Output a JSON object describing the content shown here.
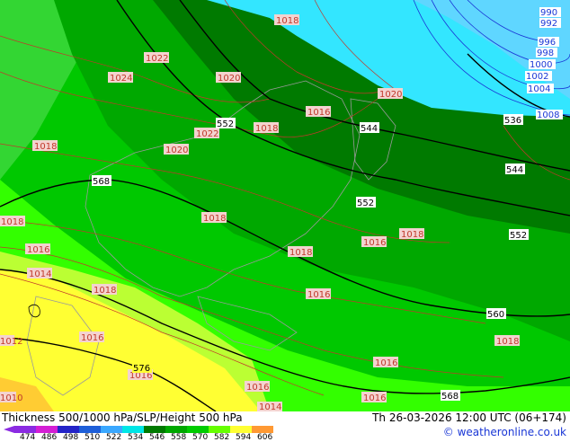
{
  "title": "Thickness 500/1000 hPa/SLP/Height 500 hPa",
  "valid_time": "Th 26-03-2026 12:00 UTC (06+174)",
  "copyright": "© weatheronline.co.uk",
  "legend": {
    "ticks": [
      "474",
      "486",
      "498",
      "510",
      "522",
      "534",
      "546",
      "558",
      "570",
      "582",
      "594",
      "606"
    ],
    "colors": [
      "#8b2be2",
      "#d41fd4",
      "#2424c8",
      "#1e5fd9",
      "#3aa8ff",
      "#00e6e6",
      "#007a00",
      "#00a800",
      "#00cc00",
      "#66ff00",
      "#ffff33",
      "#ff9933"
    ]
  },
  "slp_labels": [
    "1018",
    "1022",
    "1024",
    "1020",
    "1022",
    "1018",
    "1016",
    "1018",
    "1020",
    "1018",
    "1014",
    "1018",
    "1016",
    "1018",
    "1018",
    "1016",
    "1016",
    "1016",
    "1018",
    "1016",
    "1016",
    "1016",
    "1014",
    "1012",
    "1010",
    "1020",
    "1016",
    "1018"
  ],
  "height_labels": [
    "552",
    "544",
    "568",
    "544",
    "552",
    "552",
    "560",
    "568",
    "576",
    "536"
  ],
  "blue_labels": [
    "992",
    "996",
    "998",
    "1000",
    "1002",
    "1004",
    "1008",
    "990"
  ]
}
